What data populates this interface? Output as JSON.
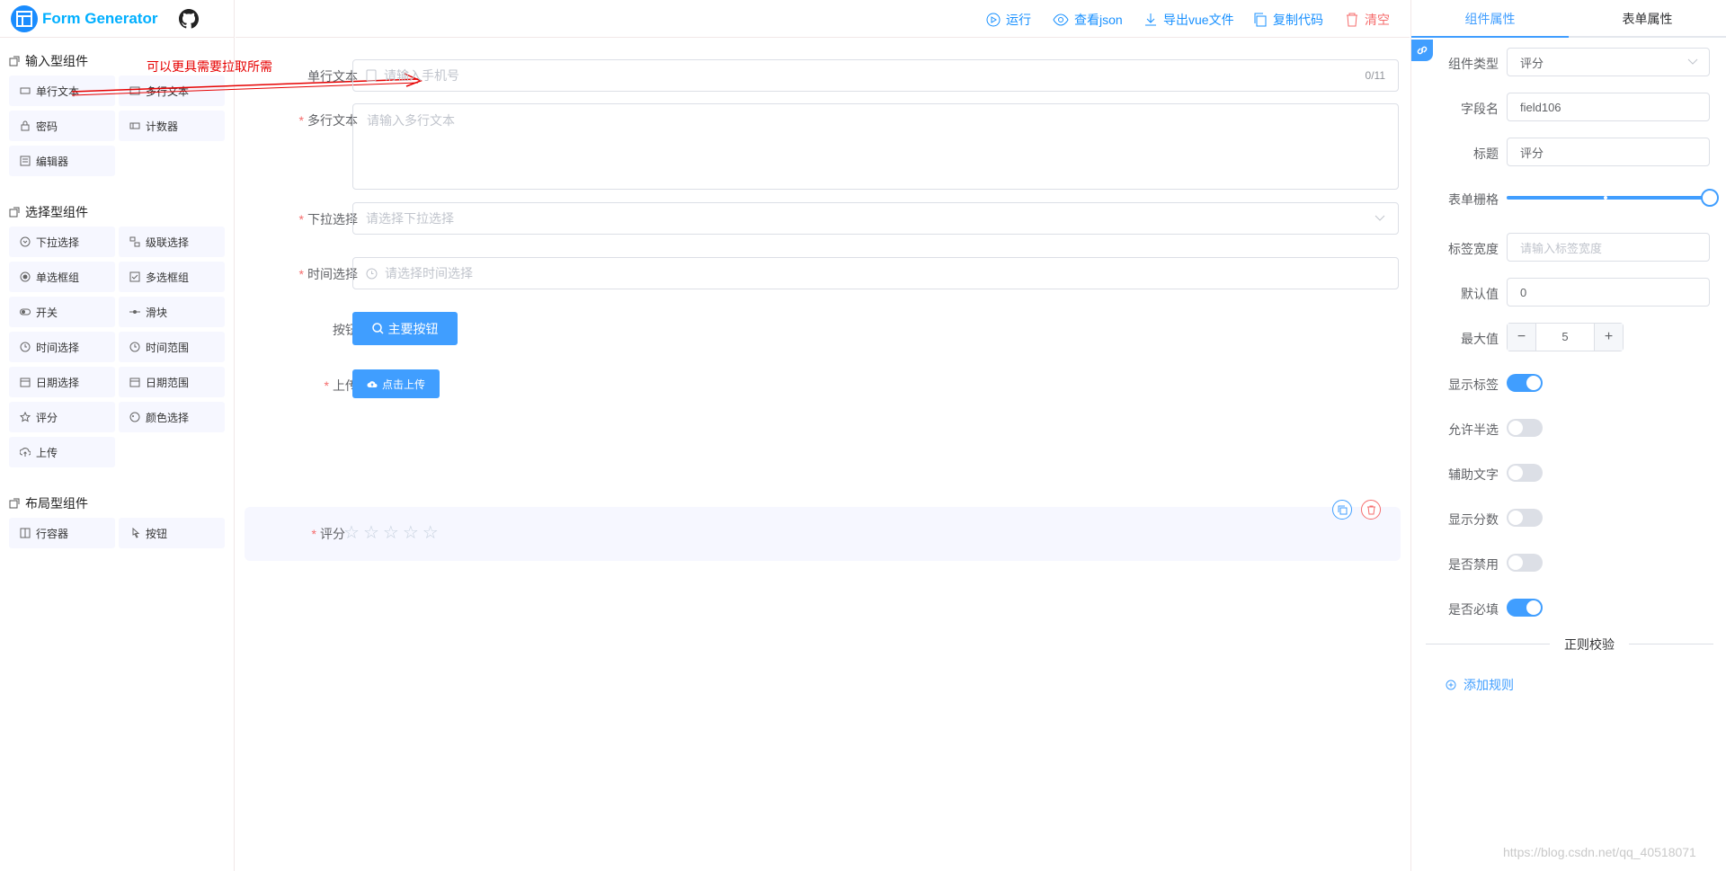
{
  "app": {
    "title": "Form Generator"
  },
  "annotation": "可以更具需要拉取所需",
  "palette": {
    "categories": [
      {
        "title": "输入型组件",
        "items": [
          "单行文本",
          "多行文本",
          "密码",
          "计数器",
          "编辑器"
        ]
      },
      {
        "title": "选择型组件",
        "items": [
          "下拉选择",
          "级联选择",
          "单选框组",
          "多选框组",
          "开关",
          "滑块",
          "时间选择",
          "时间范围",
          "日期选择",
          "日期范围",
          "评分",
          "颜色选择",
          "上传"
        ]
      },
      {
        "title": "布局型组件",
        "items": [
          "行容器",
          "按钮"
        ]
      }
    ]
  },
  "toolbar": {
    "run": "运行",
    "view_json": "查看json",
    "export_vue": "导出vue文件",
    "copy_code": "复制代码",
    "clear": "清空"
  },
  "form": {
    "single_line": {
      "label": "单行文本",
      "placeholder": "请输入手机号",
      "counter": "0/11"
    },
    "multi_line": {
      "label": "多行文本",
      "placeholder": "请输入多行文本"
    },
    "select": {
      "label": "下拉选择",
      "placeholder": "请选择下拉选择"
    },
    "time": {
      "label": "时间选择",
      "placeholder": "请选择时间选择"
    },
    "button": {
      "label": "按钮",
      "text": "主要按钮"
    },
    "upload": {
      "label": "上传",
      "text": "点击上传"
    },
    "rate": {
      "label": "评分",
      "value": 0,
      "max": 5
    }
  },
  "panel": {
    "tabs": [
      "组件属性",
      "表单属性"
    ],
    "component_type": {
      "label": "组件类型",
      "value": "评分"
    },
    "field_name": {
      "label": "字段名",
      "value": "field106"
    },
    "title": {
      "label": "标题",
      "value": "评分"
    },
    "grid": {
      "label": "表单栅格",
      "value": 24,
      "max": 24
    },
    "label_width": {
      "label": "标签宽度",
      "placeholder": "请输入标签宽度"
    },
    "default_value": {
      "label": "默认值",
      "value": "0"
    },
    "max_value": {
      "label": "最大值",
      "value": "5"
    },
    "switches": [
      {
        "label": "显示标签",
        "on": true
      },
      {
        "label": "允许半选",
        "on": false
      },
      {
        "label": "辅助文字",
        "on": false
      },
      {
        "label": "显示分数",
        "on": false
      },
      {
        "label": "是否禁用",
        "on": false
      },
      {
        "label": "是否必填",
        "on": true
      }
    ],
    "regex_title": "正则校验",
    "add_rule": "添加规则"
  },
  "watermark": "https://blog.csdn.net/qq_40518071",
  "colors": {
    "primary": "#409eff",
    "danger": "#f56c6c",
    "logo": "#00afff"
  }
}
